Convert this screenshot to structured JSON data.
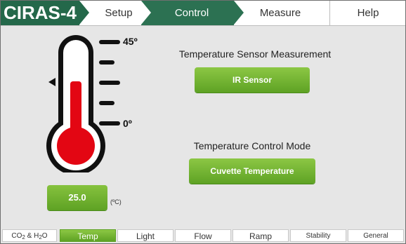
{
  "header": {
    "brand": "CIRAS-4",
    "tabs": [
      {
        "label": "Setup",
        "active": false
      },
      {
        "label": "Control",
        "active": true
      },
      {
        "label": "Measure",
        "active": false
      },
      {
        "label": "Help",
        "active": false
      }
    ]
  },
  "thermometer": {
    "max_label": "45º",
    "min_label": "0º",
    "fill_color": "#e30613",
    "marker_icon": "triangle-pointer-icon"
  },
  "temperature": {
    "value": "25.0",
    "unit": "(ºC)"
  },
  "sensor_section": {
    "title": "Temperature Sensor Measurement",
    "button_label": "IR Sensor"
  },
  "control_section": {
    "title": "Temperature Control Mode",
    "button_label": "Cuvette Temperature"
  },
  "bottom_tabs": {
    "co2_prefix": "CO",
    "co2_sub": "2",
    "co2_mid": " & H",
    "h2o_sub": "2",
    "h2o_suffix": "O",
    "items": [
      {
        "label": "Temp",
        "active": true
      },
      {
        "label": "Light",
        "active": false
      },
      {
        "label": "Flow",
        "active": false
      },
      {
        "label": "Ramp",
        "active": false
      },
      {
        "label": "Stability",
        "active": false
      },
      {
        "label": "General",
        "active": false
      }
    ]
  },
  "colors": {
    "brand_green": "#24684a",
    "active_tab_green": "#2c7152",
    "button_green": "#6bb02c",
    "mercury_red": "#e30613"
  }
}
